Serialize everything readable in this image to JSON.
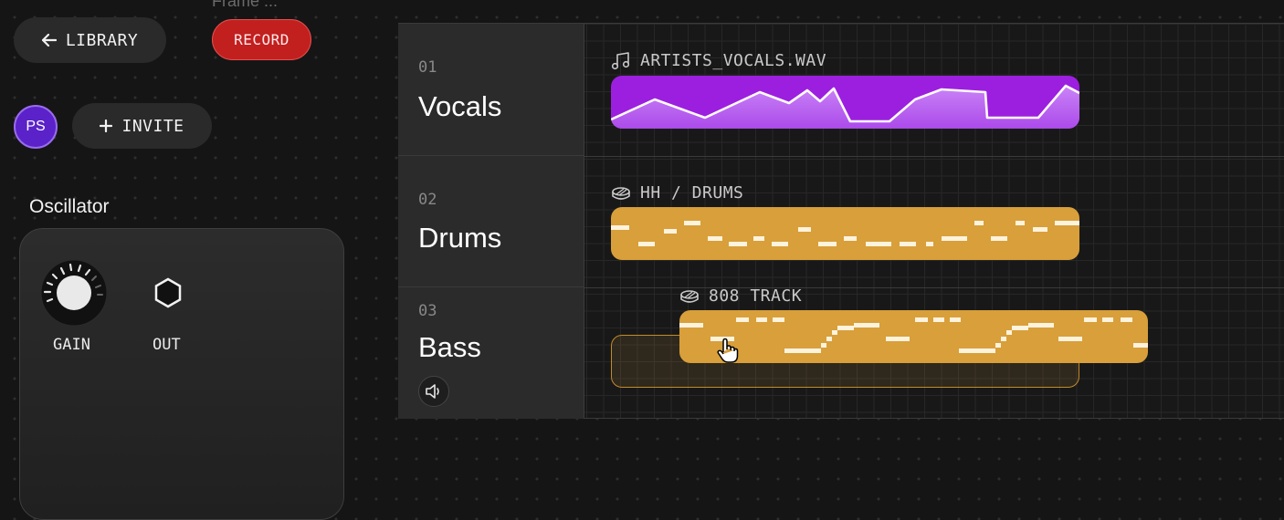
{
  "frame_label": "Frame ...",
  "toolbar": {
    "library_label": "LIBRARY",
    "record_label": "RECORD"
  },
  "collab": {
    "avatar_initials": "PS",
    "invite_label": "INVITE"
  },
  "oscillator": {
    "title": "Oscillator",
    "gain_label": "GAIN",
    "out_label": "OUT"
  },
  "tracks": [
    {
      "number": "01",
      "name": "Vocals",
      "clip_name": "ARTISTS_VOCALS.WAV",
      "clip_icon": "music-note-icon",
      "clip_color": "#9c1fdf"
    },
    {
      "number": "02",
      "name": "Drums",
      "clip_name": "HH / DRUMS",
      "clip_icon": "drum-icon",
      "clip_color": "#d89f3a"
    },
    {
      "number": "03",
      "name": "Bass",
      "clip_name": "808 TRACK",
      "clip_icon": "drum-icon",
      "clip_color": "#d89f3a"
    }
  ],
  "colors": {
    "record": "#c21f1f",
    "avatar": "#5a22c8",
    "vocals_clip": "#9c1fdf",
    "drum_clip": "#d89f3a"
  }
}
